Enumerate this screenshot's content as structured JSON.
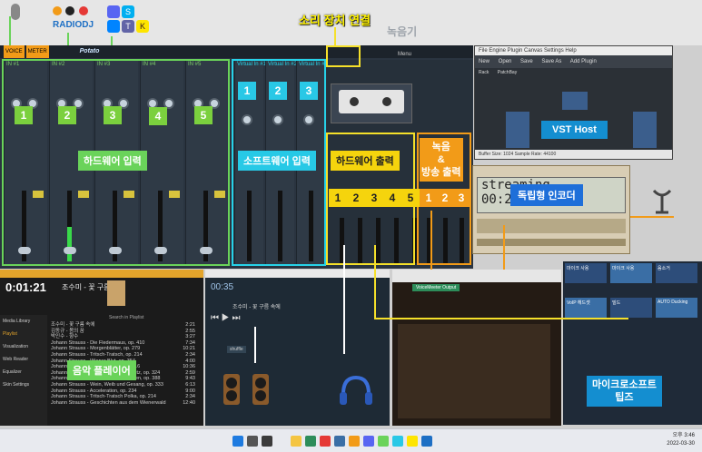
{
  "annotations": {
    "sound_device_connect": "소리 장치 연결",
    "recorder": "녹음기",
    "hardware_input": "하드웨어 입력",
    "software_input": "소프트웨어 입력",
    "hardware_output": "하드웨어 출력",
    "rec_broadcast_output_line1": "녹음",
    "rec_broadcast_output_line2": "&",
    "rec_broadcast_output_line3": "방송 출력",
    "vst_host": "VST Host",
    "standalone_encoder": "독립형 인코더",
    "music_player": "음악 플레이어",
    "microsoft_tips_line1": "마이크로소프트",
    "microsoft_tips_line2": "팁즈"
  },
  "numbers": {
    "hw_in": [
      "1",
      "2",
      "3",
      "4",
      "5"
    ],
    "sw_in": [
      "1",
      "2",
      "3"
    ],
    "hw_out": [
      "1",
      "2",
      "3",
      "4",
      "5"
    ],
    "rec_out": [
      "1",
      "2",
      "3"
    ]
  },
  "topbar": {
    "radiodj": "RADIODJ",
    "icons": [
      "mic-icon",
      "radiodj-icon",
      "discord-icon",
      "skype-icon",
      "teams-icon",
      "kakaotalk-icon"
    ]
  },
  "voicemeeter": {
    "tags": [
      "VOICE",
      "METER"
    ],
    "logo": "Potato",
    "hw_labels": [
      "IN #1",
      "IN #2",
      "IN #3",
      "IN #4",
      "IN #5"
    ],
    "sw_labels": [
      "Virtual In #1",
      "Virtual In #2",
      "Virtual In #3"
    ],
    "menu": "Menu"
  },
  "vst": {
    "menu": "File  Engine  Plugin  Canvas  Settings  Help",
    "toolbar": [
      "New",
      "Open",
      "Save",
      "Save As",
      "Add Plugin"
    ],
    "tabs": [
      "Rack",
      "PatchBay"
    ],
    "status": "Buffer Size: 1024    Sample Rate: 44100"
  },
  "encoder": {
    "screen": "streaming",
    "time": "00:2"
  },
  "player": {
    "time": "0:01:21",
    "now_playing": "조수미 - 꽃 구름 속에",
    "sidebar": [
      "Media Library",
      "Playlist",
      "Visualization",
      "Web Reader",
      "Equalizer",
      "Skin Settings"
    ],
    "search": "Search in Playlist",
    "tracks": [
      {
        "t": "조수미 - 꽃 구름 속에",
        "d": "2:21"
      },
      {
        "t": "김동규 - 봄의 꿈",
        "d": "2:55"
      },
      {
        "t": "박인수 - 향수",
        "d": "3:27"
      },
      {
        "t": "Johann Strauss - Die Fledermaus, op. 410",
        "d": "7:34"
      },
      {
        "t": "Johann Strauss - Morgenblätter, op. 279",
        "d": "10:21"
      },
      {
        "t": "Johann Strauss - Tritsch-Tratsch, op. 214",
        "d": "2:34"
      },
      {
        "t": "Johann Strauss - Wiener Blut, op. 354",
        "d": "4:00"
      },
      {
        "t": "Johann Strauss - Künstlerleben, op. 316",
        "d": "10:36"
      },
      {
        "t": "Johann Strauss - Unter Donner und Blitz, op. 324",
        "d": "2:59"
      },
      {
        "t": "Johann Strauss - Rosen aus dem Süden, op. 388",
        "d": "9:43"
      },
      {
        "t": "Johann Strauss - Wein, Weib und Gesang, op. 333",
        "d": "6:13"
      },
      {
        "t": "Johann Strauss - Acceleration, op. 234",
        "d": "9:00"
      },
      {
        "t": "Johann Strauss - Tritsch-Tratsch Polka, op. 214",
        "d": "2:34"
      },
      {
        "t": "Johann Strauss - Geschichten aus dem Wienerwald",
        "d": "12:40"
      }
    ]
  },
  "stream": {
    "time": "00:35",
    "title": "조수미 - 꽃 구름 속에",
    "shuffle": "shuffle"
  },
  "chat": {
    "device": "VoiceMeeter Output"
  },
  "tiles": [
    {
      "label": "마이크 사용",
      "color": "#2d4d7a"
    },
    {
      "label": "마이크 사용",
      "color": "#3a6ea5"
    },
    {
      "label": "음소거",
      "color": "#2d4d7a"
    },
    {
      "label": "VoIP 헤드셋",
      "color": "#3a6ea5"
    },
    {
      "label": "빌드",
      "color": "#2d4d7a"
    },
    {
      "label": "AUTO Ducking",
      "color": "#3a6ea5"
    }
  ],
  "taskbar": {
    "time": "오후 3:46",
    "date": "2022-03-30"
  }
}
